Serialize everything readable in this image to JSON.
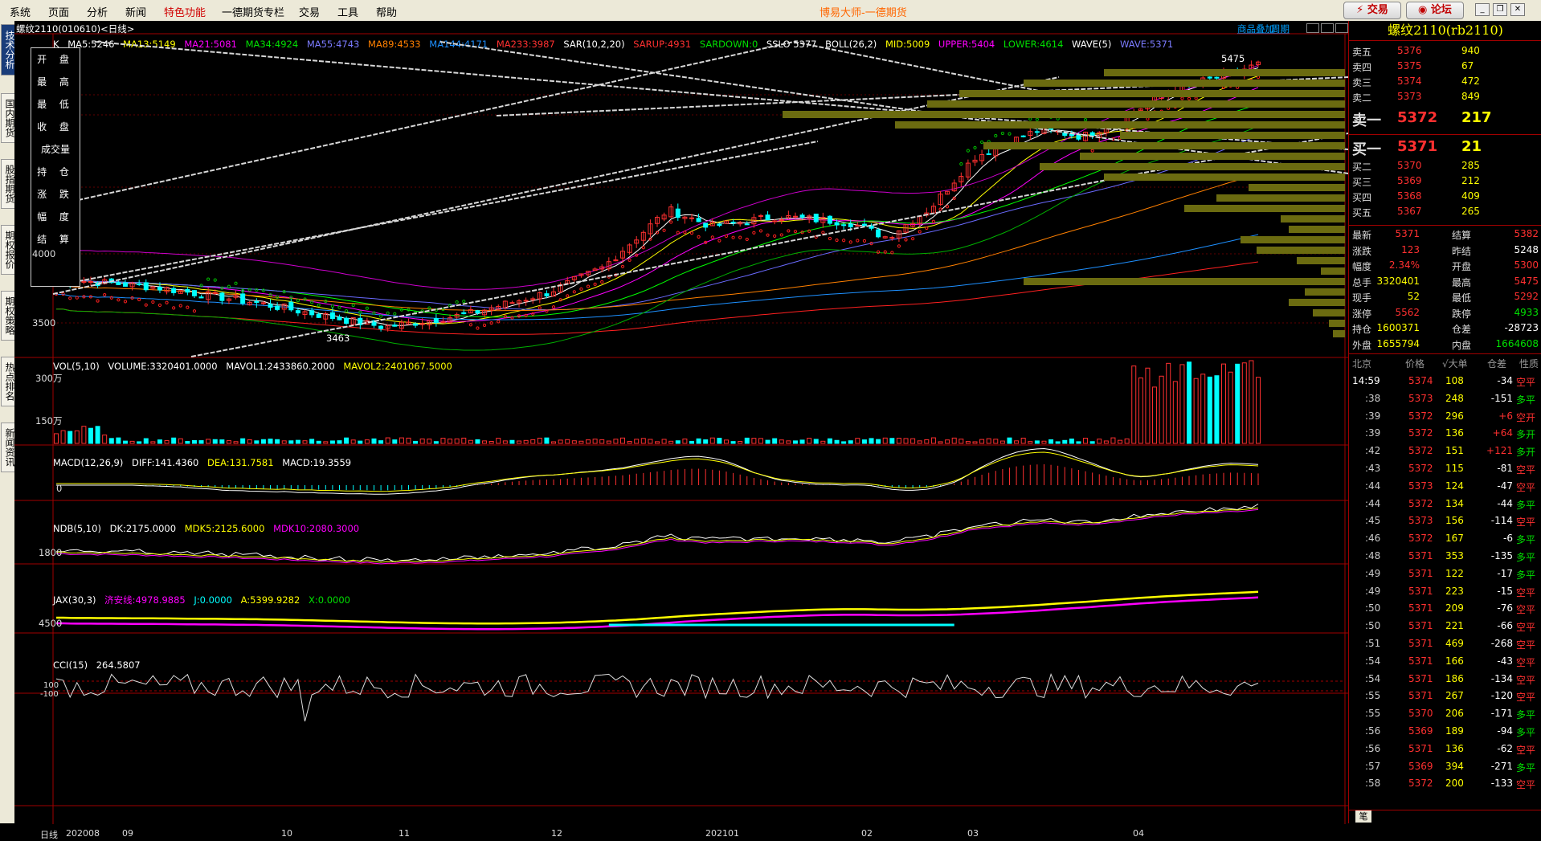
{
  "menu": {
    "items": [
      "系统",
      "页面",
      "分析",
      "新闻",
      "特色功能",
      "一德期货专栏",
      "交易",
      "工具",
      "帮助"
    ],
    "title": "博易大师-一德期货",
    "trade_btn": "交易",
    "forum_btn": "论坛"
  },
  "left_tabs": [
    "技术分析",
    "国内期货",
    "股指期货",
    "期权报价",
    "期权策略",
    "热点排名",
    "新闻资讯"
  ],
  "chart": {
    "title": "螺纹2110(010610)<日线>",
    "links": [
      "商品叠加",
      "周期"
    ],
    "ma_header": [
      "K",
      "MA5:5246",
      "MA13:5149",
      "MA21:5081",
      "MA34:4924",
      "MA55:4743",
      "MA89:4533",
      "MA144:4171",
      "MA233:3987",
      "SAR(10,2,20)",
      "SARUP:4931",
      "SARDOWN:0",
      "SSLO 5377",
      "BOLL(26,2)",
      "MID:5009",
      "UPPER:5404",
      "LOWER:4614",
      "WAVE(5)",
      "WAVE:5371"
    ],
    "ohlc_labels": [
      "开 盘",
      "最 高",
      "最 低",
      "收 盘",
      "成交量",
      "持 仓",
      "涨 跌",
      "幅 度",
      "结 算"
    ],
    "price_axis": [
      "4000",
      "3500"
    ],
    "high_label": "5475",
    "low_label": "3463",
    "vol_header": [
      "VOL(5,10)",
      "VOLUME:3320401.0000",
      "MAVOL1:2433860.2000",
      "MAVOL2:2401067.5000"
    ],
    "vol_axis": [
      "300万",
      "150万"
    ],
    "macd_header": [
      "MACD(12,26,9)",
      "DIFF:141.4360",
      "DEA:131.7581",
      "MACD:19.3559"
    ],
    "macd_axis": [
      "0"
    ],
    "ndb_header": [
      "NDB(5,10)",
      "DK:2175.0000",
      "MDK5:2125.6000",
      "MDK10:2080.3000"
    ],
    "ndb_axis": [
      "1800"
    ],
    "jax_header": [
      "JAX(30,3)",
      "济安线:4978.9885",
      "J:0.0000",
      "A:5399.9282",
      "X:0.0000"
    ],
    "jax_axis": [
      "4500"
    ],
    "cci_header": [
      "CCI(15)",
      "264.5807"
    ],
    "cci_axis": [
      "100",
      "-100"
    ],
    "dates": [
      "日线",
      "202008",
      "09",
      "10",
      "11",
      "12",
      "202101",
      "02",
      "03",
      "04"
    ],
    "colors": {
      "up": "#ff3030",
      "down": "#00ffff",
      "ma5": "#ffffff",
      "ma13": "#ffff00",
      "ma21": "#ff00ff",
      "ma34": "#00ff00",
      "ma55": "#6a6aff",
      "ma89": "#ff8000",
      "ma144": "#1e90ff",
      "ma233": "#ff2020",
      "grid": "#a00000"
    }
  },
  "quote": {
    "title": "螺纹2110(rb2110)",
    "asks": [
      {
        "label": "卖五",
        "price": "5376",
        "vol": "940"
      },
      {
        "label": "卖四",
        "price": "5375",
        "vol": "67"
      },
      {
        "label": "卖三",
        "price": "5374",
        "vol": "472"
      },
      {
        "label": "卖二",
        "price": "5373",
        "vol": "849"
      },
      {
        "label": "卖一",
        "price": "5372",
        "vol": "217"
      }
    ],
    "bids": [
      {
        "label": "买一",
        "price": "5371",
        "vol": "21"
      },
      {
        "label": "买二",
        "price": "5370",
        "vol": "285"
      },
      {
        "label": "买三",
        "price": "5369",
        "vol": "212"
      },
      {
        "label": "买四",
        "price": "5368",
        "vol": "409"
      },
      {
        "label": "买五",
        "price": "5367",
        "vol": "265"
      }
    ],
    "stats": [
      [
        "最新",
        "5371",
        "结算",
        "5382"
      ],
      [
        "涨跌",
        "123",
        "昨结",
        "5248"
      ],
      [
        "幅度",
        "2.34%",
        "开盘",
        "5300"
      ],
      [
        "总手",
        "3320401",
        "最高",
        "5475"
      ],
      [
        "现手",
        "52",
        "最低",
        "5292"
      ],
      [
        "涨停",
        "5562",
        "跌停",
        "4933"
      ],
      [
        "持仓",
        "1600371",
        "仓差",
        "-28723"
      ],
      [
        "外盘",
        "1655794",
        "内盘",
        "1664608"
      ]
    ],
    "tick_header": [
      "北京",
      "价格",
      "√大单",
      "仓差",
      "性质"
    ],
    "ticks": [
      [
        "14:59",
        "5374",
        "108",
        "-34",
        "空平"
      ],
      [
        ":38",
        "5373",
        "248",
        "-151",
        "多平"
      ],
      [
        ":39",
        "5372",
        "296",
        "+6",
        "空开"
      ],
      [
        ":39",
        "5372",
        "136",
        "+64",
        "多开"
      ],
      [
        ":42",
        "5372",
        "151",
        "+121",
        "多开"
      ],
      [
        ":43",
        "5372",
        "115",
        "-81",
        "空平"
      ],
      [
        ":44",
        "5373",
        "124",
        "-47",
        "空平"
      ],
      [
        ":44",
        "5372",
        "134",
        "-44",
        "多平"
      ],
      [
        ":45",
        "5373",
        "156",
        "-114",
        "空平"
      ],
      [
        ":46",
        "5372",
        "167",
        "-6",
        "多平"
      ],
      [
        ":48",
        "5371",
        "353",
        "-135",
        "多平"
      ],
      [
        ":49",
        "5371",
        "122",
        "-17",
        "多平"
      ],
      [
        ":49",
        "5371",
        "223",
        "-15",
        "空平"
      ],
      [
        ":50",
        "5371",
        "209",
        "-76",
        "空平"
      ],
      [
        ":50",
        "5371",
        "221",
        "-66",
        "空平"
      ],
      [
        ":51",
        "5371",
        "469",
        "-268",
        "空平"
      ],
      [
        ":54",
        "5371",
        "166",
        "-43",
        "空平"
      ],
      [
        ":54",
        "5371",
        "186",
        "-134",
        "空平"
      ],
      [
        ":55",
        "5371",
        "267",
        "-120",
        "空平"
      ],
      [
        ":55",
        "5370",
        "206",
        "-171",
        "多平"
      ],
      [
        ":56",
        "5369",
        "189",
        "-94",
        "多平"
      ],
      [
        ":56",
        "5371",
        "136",
        "-62",
        "空平"
      ],
      [
        ":57",
        "5369",
        "394",
        "-271",
        "多平"
      ],
      [
        ":58",
        "5372",
        "200",
        "-133",
        "空平"
      ]
    ],
    "footer_tab": "笔"
  }
}
